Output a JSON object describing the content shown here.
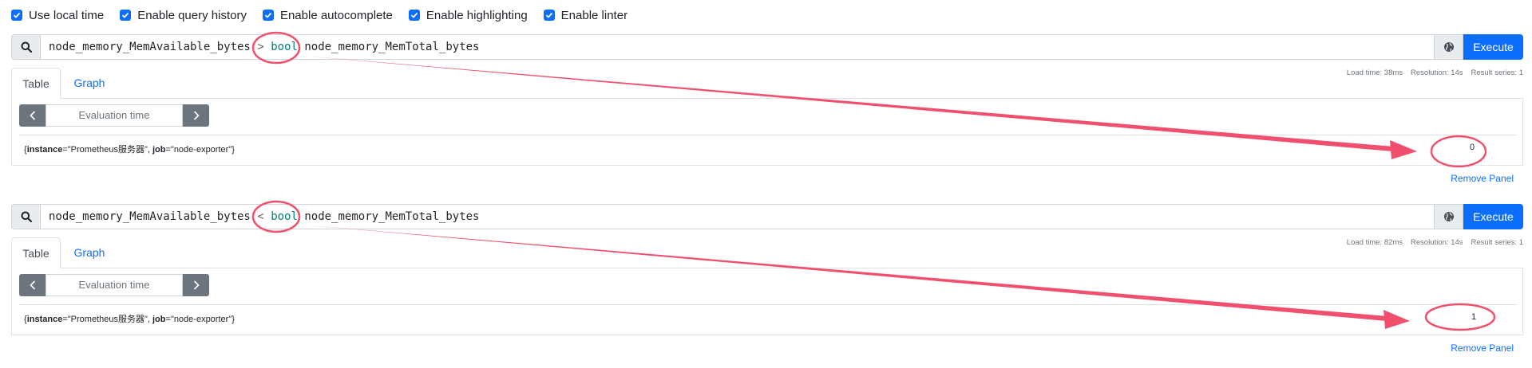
{
  "options": [
    {
      "label": "Use local time",
      "checked": true
    },
    {
      "label": "Enable query history",
      "checked": true
    },
    {
      "label": "Enable autocomplete",
      "checked": true
    },
    {
      "label": "Enable highlighting",
      "checked": true
    },
    {
      "label": "Enable linter",
      "checked": true
    }
  ],
  "panels": [
    {
      "query": {
        "left_metric": "node_memory_MemAvailable_bytes",
        "operator": ">",
        "modifier": "bool",
        "right_metric": "node_memory_MemTotal_bytes"
      },
      "execute_label": "Execute",
      "stats": {
        "load_time": "Load time: 38ms",
        "resolution": "Resolution: 14s",
        "result_series": "Result series: 1"
      },
      "tabs": {
        "table": "Table",
        "graph": "Graph"
      },
      "eval_placeholder": "Evaluation time",
      "result": {
        "open": "{",
        "instance_key": "instance",
        "instance_val": "=\"Prometheus服务器\", ",
        "job_key": "job",
        "job_val": "=\"node-exporter\"}",
        "value": "0"
      },
      "remove_label": "Remove Panel"
    },
    {
      "query": {
        "left_metric": "node_memory_MemAvailable_bytes",
        "operator": "<",
        "modifier": "bool",
        "right_metric": "node_memory_MemTotal_bytes"
      },
      "execute_label": "Execute",
      "stats": {
        "load_time": "Load time: 82ms",
        "resolution": "Resolution: 14s",
        "result_series": "Result series: 1"
      },
      "tabs": {
        "table": "Table",
        "graph": "Graph"
      },
      "eval_placeholder": "Evaluation time",
      "result": {
        "open": "{",
        "instance_key": "instance",
        "instance_val": "=\"Prometheus服务器\", ",
        "job_key": "job",
        "job_val": "=\"node-exporter\"}",
        "value": "1"
      },
      "remove_label": "Remove Panel"
    }
  ],
  "colors": {
    "accent": "#0d6efd",
    "annotation": "#f0506e"
  }
}
